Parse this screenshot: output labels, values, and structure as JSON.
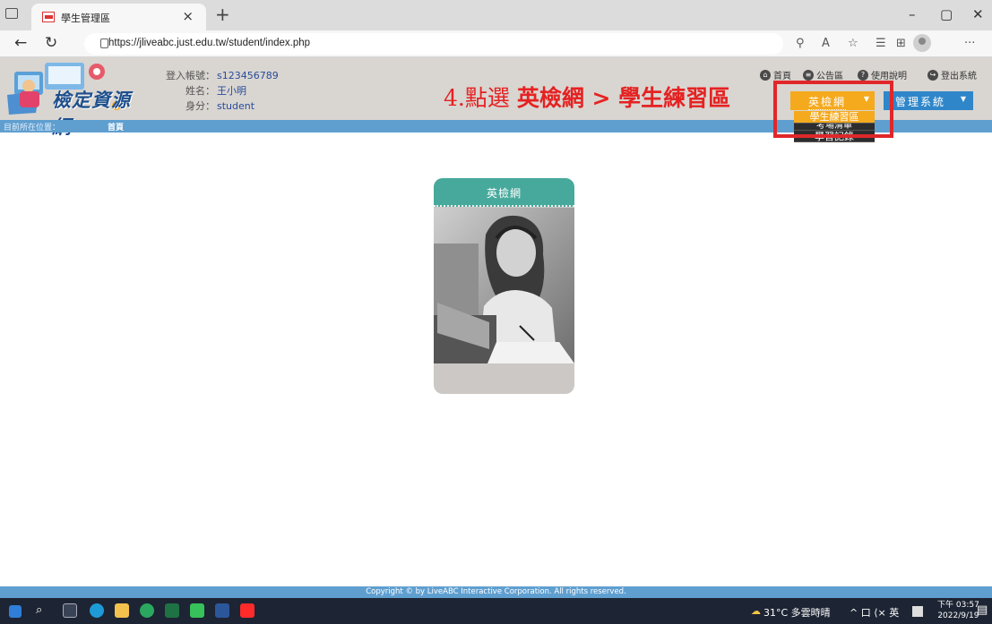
{
  "browser": {
    "tab_title": "學生管理區",
    "tab_close": "×",
    "new_tab": "+",
    "url": "https://jliveabc.just.edu.tw/student/index.php",
    "win_min": "–",
    "win_restore": "▢",
    "win_close": "✕"
  },
  "header": {
    "logo_text": "檢定資源網",
    "info_labels": [
      "登入帳號：",
      "姓名：",
      "身分："
    ],
    "account": "s123456789",
    "name": "王小明",
    "role": "student",
    "links": [
      {
        "icon": "home-icon",
        "glyph": "⌂",
        "label": "首頁"
      },
      {
        "icon": "bulletin-icon",
        "glyph": "≡",
        "label": "公告區"
      },
      {
        "icon": "help-icon",
        "glyph": "?",
        "label": "使用說明"
      },
      {
        "icon": "logout-icon",
        "glyph": "↪",
        "label": "登出系統"
      }
    ],
    "english_button": "英檢網",
    "manage_button": "管理系統",
    "caret": "▼"
  },
  "annotation": {
    "prefix": "4.點選 ",
    "strong": "英檢網 > 學生練習區"
  },
  "dropdown": {
    "items": [
      "學生練習區",
      "考場清單",
      "學習記錄"
    ]
  },
  "breadcrumb": {
    "label": "目前所在位置：",
    "value": "首頁"
  },
  "card": {
    "title": "英檢網"
  },
  "footer": {
    "copyright": "Copyright © by LiveABC Interactive Corporation. All rights reserved."
  },
  "taskbar": {
    "weather": "31°C 多雲時晴",
    "tray": "^ 口 ⟨× 英",
    "time": "下午 03:57",
    "date": "2022/9/19"
  },
  "colors": {
    "annotation_red": "#e52222",
    "english_orange": "#f5a91d",
    "manage_blue": "#2f86c9",
    "bar_blue": "#5f9fd0",
    "card_teal": "#46a99c"
  }
}
